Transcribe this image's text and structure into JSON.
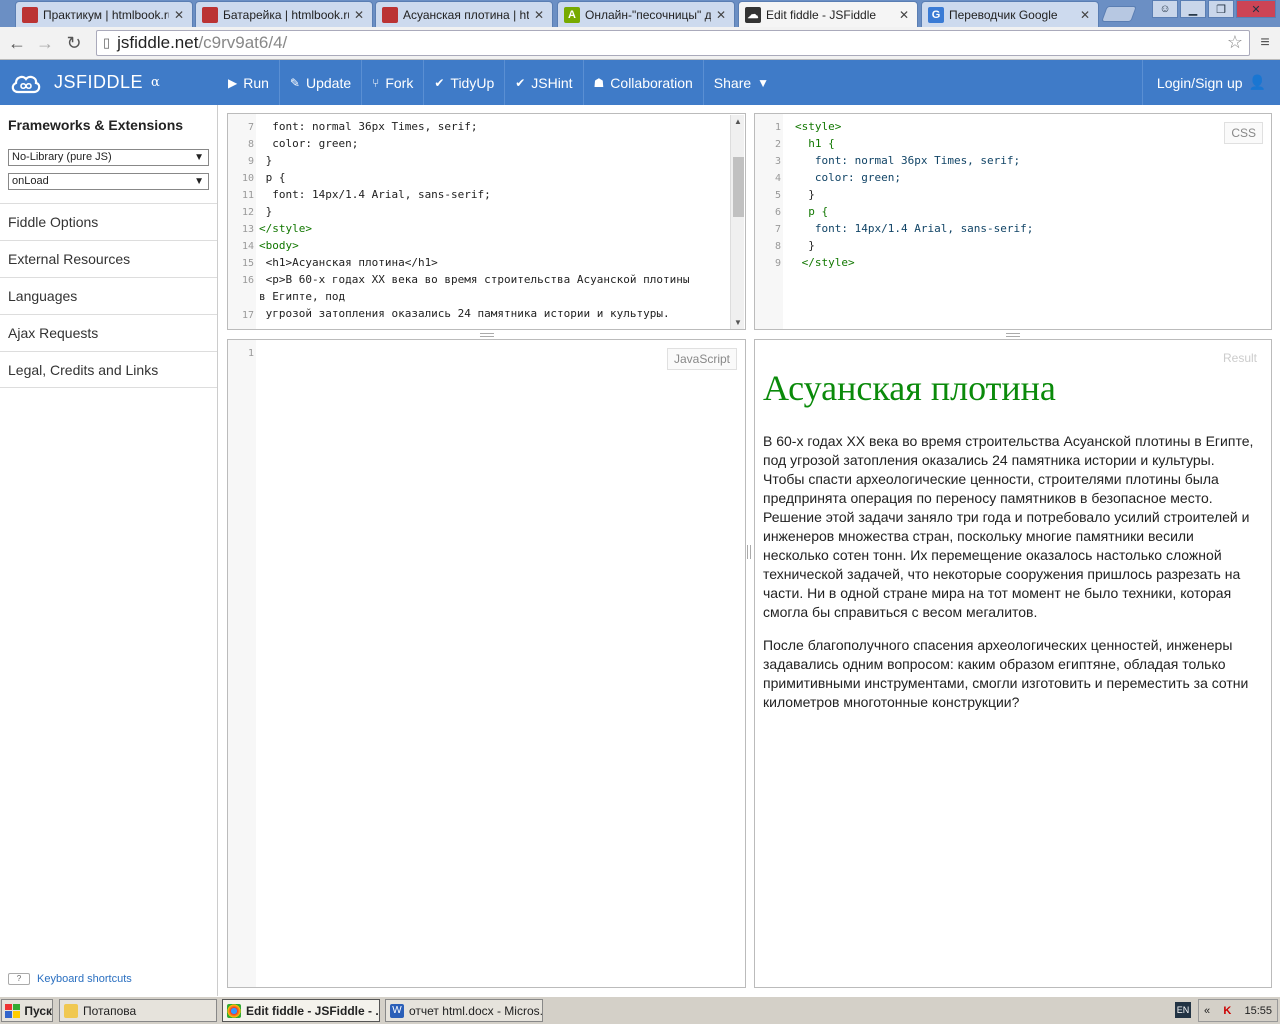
{
  "browser": {
    "tabs": [
      {
        "title": "Практикум | htmlbook.ru",
        "icon": "htmlbook-icon",
        "color": "#b33"
      },
      {
        "title": "Батарейка | htmlbook.ru",
        "icon": "htmlbook-icon",
        "color": "#b33"
      },
      {
        "title": "Асуанская плотина | htm",
        "icon": "htmlbook-icon",
        "color": "#b33"
      },
      {
        "title": "Онлайн-\"песочницы\" для",
        "icon": "a-letter-icon",
        "color": "#7a0"
      },
      {
        "title": "Edit fiddle - JSFiddle",
        "icon": "jsfiddle-icon",
        "color": "#333",
        "active": true
      },
      {
        "title": "Переводчик Google",
        "icon": "google-translate-icon",
        "color": "#3a7bd5"
      }
    ],
    "address": {
      "host": "jsfiddle.net",
      "path": "/c9rv9at6/4/"
    }
  },
  "header": {
    "logo_text": "JSFIDDLE",
    "alpha": "α",
    "buttons": [
      {
        "label": "Run",
        "icon": "play-icon",
        "glyph": "▶"
      },
      {
        "label": "Update",
        "icon": "pencil-icon",
        "glyph": "✎"
      },
      {
        "label": "Fork",
        "icon": "fork-icon",
        "glyph": "⑂"
      },
      {
        "label": "TidyUp",
        "icon": "check-icon",
        "glyph": "✔"
      },
      {
        "label": "JSHint",
        "icon": "check-icon",
        "glyph": "✔"
      },
      {
        "label": "Collaboration",
        "icon": "users-icon",
        "glyph": "☗"
      },
      {
        "label": "Share",
        "icon": "caret-down-icon",
        "glyph": "▼"
      }
    ],
    "login": "Login/Sign up"
  },
  "sidebar": {
    "title": "Frameworks & Extensions",
    "library_select": "No-Library (pure JS)",
    "load_select": "onLoad",
    "items": [
      "Fiddle Options",
      "External Resources",
      "Languages",
      "Ajax Requests",
      "Legal, Credits and Links"
    ],
    "keyboard": "Keyboard shortcuts",
    "keyboard_key": "?"
  },
  "html_panel": {
    "lines": [
      {
        "n": "7",
        "code": "  font: normal 36px Times, serif;"
      },
      {
        "n": "8",
        "code": "  color: green;"
      },
      {
        "n": "9",
        "code": " }"
      },
      {
        "n": "10",
        "code": " p {"
      },
      {
        "n": "11",
        "code": "  font: 14px/1.4 Arial, sans-serif;"
      },
      {
        "n": "12",
        "code": " }"
      },
      {
        "n": "13",
        "code": "</style>"
      },
      {
        "n": "14",
        "code": "<body>"
      },
      {
        "n": "15",
        "code": " <h1>Асуанская плотина</h1>"
      },
      {
        "n": "16",
        "code": " <p>В 60-х годах XX века во время строительства Асуанской плотины"
      },
      {
        "n": "",
        "code": "в Египте, под"
      },
      {
        "n": "17",
        "code": " угрозой затопления оказались 24 памятника истории и культуры."
      }
    ]
  },
  "css_panel": {
    "label": "CSS",
    "lines": [
      {
        "n": "1",
        "code": "<style>"
      },
      {
        "n": "2",
        "code": "  h1 {"
      },
      {
        "n": "3",
        "code": "   font: normal 36px Times, serif;"
      },
      {
        "n": "4",
        "code": "   color: green;"
      },
      {
        "n": "5",
        "code": "  }"
      },
      {
        "n": "6",
        "code": "  p {"
      },
      {
        "n": "7",
        "code": "   font: 14px/1.4 Arial, sans-serif;"
      },
      {
        "n": "8",
        "code": "  }"
      },
      {
        "n": "9",
        "code": " </style>"
      }
    ]
  },
  "js_panel": {
    "label": "JavaScript",
    "line1": "1"
  },
  "result": {
    "label": "Result",
    "h1": "Асуанская плотина",
    "p1_lines": [
      "В 60-х годах XX века во время строительства Асуанской плотины в Египте,",
      "под угрозой затопления оказались 24 памятника истории и культуры.",
      "Чтобы спасти археологические ценности, строителями плотины была",
      "предпринята операция по переносу памятников в безопасное место.",
      "Решение этой задачи заняло три года и потребовало усилий строителей и",
      "инженеров множества стран, поскольку многие памятники весили",
      "несколько сотен тонн. Их перемещение оказалось настолько сложной",
      "технической задачей, что некоторые сооружения пришлось разрезать на",
      "части. Ни в одной стране мира на тот момент не было техники, которая",
      "смогла бы справиться с весом мегалитов."
    ],
    "p2_lines": [
      "После благополучного спасения археологических ценностей, инженеры",
      "задавались одним вопросом: каким образом египтяне, обладая только",
      "примитивными инструментами, смогли изготовить и переместить за сотни",
      "километров многотонные конструкции?"
    ]
  },
  "taskbar": {
    "start": "Пуск",
    "items": [
      {
        "label": "Потапова",
        "icon": "folder-icon"
      },
      {
        "label": "Edit fiddle - JSFiddle - ...",
        "icon": "chrome-icon",
        "active": true
      },
      {
        "label": "отчет html.docx - Micros...",
        "icon": "word-icon"
      }
    ],
    "lang": "EN",
    "time": "15:55"
  }
}
